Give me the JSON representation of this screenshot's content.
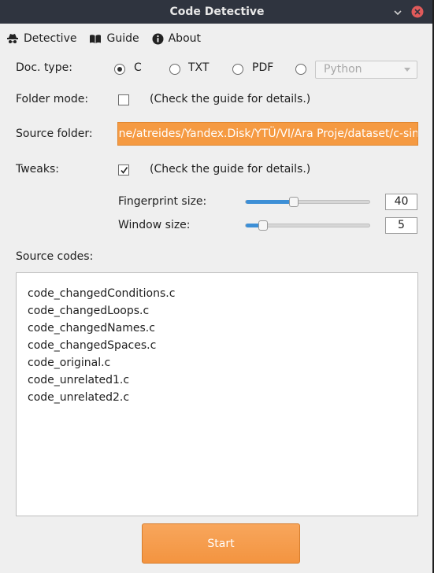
{
  "window": {
    "title": "Code Detective"
  },
  "menu": {
    "items": [
      {
        "label": "Detective",
        "icon": "detective-hat-icon"
      },
      {
        "label": "Guide",
        "icon": "open-book-icon"
      },
      {
        "label": "About",
        "icon": "info-icon"
      }
    ]
  },
  "doc_type": {
    "label": "Doc. type:",
    "options": [
      "C",
      "TXT",
      "PDF"
    ],
    "selected": "C",
    "language_select": {
      "value": "Python",
      "enabled": false
    }
  },
  "folder_mode": {
    "label": "Folder mode:",
    "checked": false,
    "hint": "(Check the guide for details.)"
  },
  "source_folder": {
    "label": "Source folder:",
    "value": "/home/atreides/Yandex.Disk/YTÜ/VI/Ara Proje/dataset/c-sim",
    "visible_text": "ne/atreides/Yandex.Disk/YTÜ/VI/Ara Proje/dataset/c-sin"
  },
  "tweaks": {
    "label": "Tweaks:",
    "checked": true,
    "hint": "(Check the guide for details.)",
    "fingerprint": {
      "label": "Fingerprint size:",
      "value": "40",
      "slider_fraction": 0.38
    },
    "window": {
      "label": "Window size:",
      "value": "5",
      "slider_fraction": 0.11
    }
  },
  "source_codes": {
    "label": "Source codes:",
    "files": [
      "code_changedConditions.c",
      "code_changedLoops.c",
      "code_changedNames.c",
      "code_changedSpaces.c",
      "code_original.c",
      "code_unrelated1.c",
      "code_unrelated2.c"
    ]
  },
  "start_button": {
    "label": "Start"
  },
  "colors": {
    "accent": "#f39440",
    "slider_fill": "#3d8fd6",
    "titlebar": "#2f343f",
    "close": "#e05a5a"
  }
}
